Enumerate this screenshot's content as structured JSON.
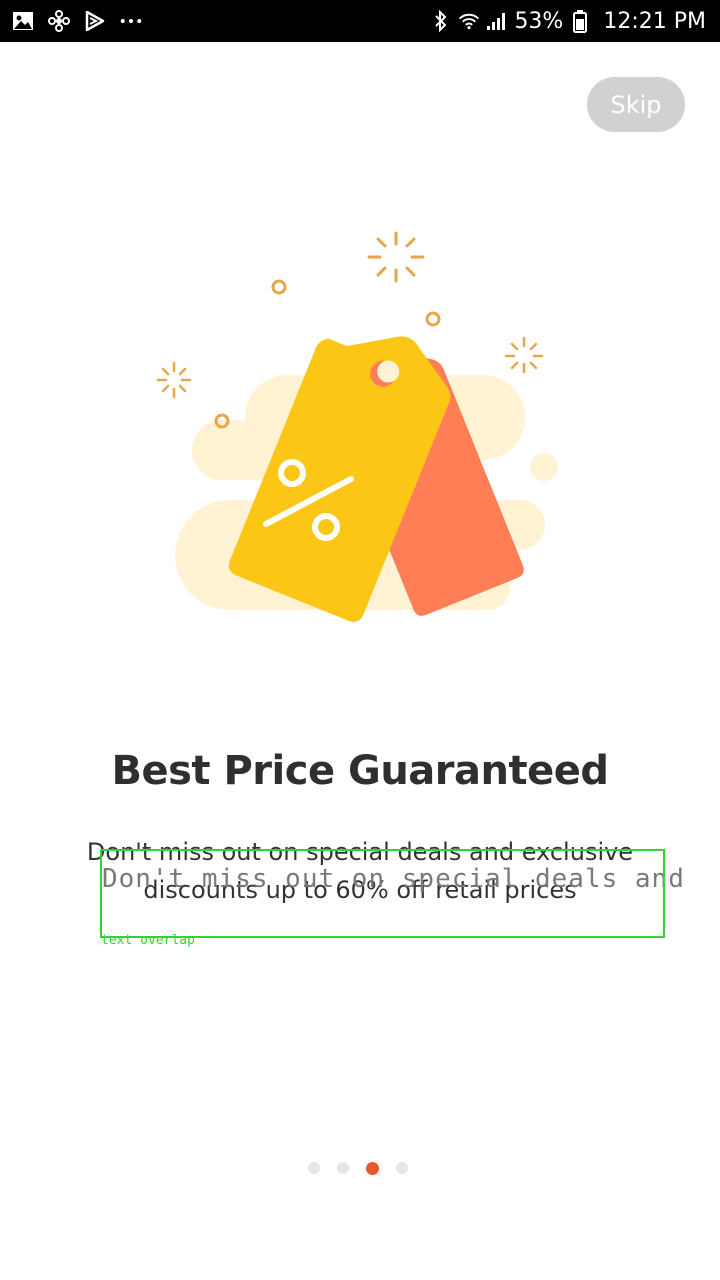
{
  "status_bar": {
    "left_icons": [
      "gallery-icon",
      "pinwheel-icon",
      "play-store-icon",
      "more-dots-icon"
    ],
    "right_icons": [
      "bluetooth-icon",
      "wifi-icon",
      "signal-icon",
      "battery-icon"
    ],
    "battery": "53%",
    "time": "12:21 PM"
  },
  "skip": {
    "label": "Skip"
  },
  "onboarding": {
    "title": "Best Price Guaranteed",
    "description": "Don't miss out on special deals and exclusive discounts up to 60% off retail prices"
  },
  "debug_overlay": {
    "text": "Don't miss out on special deals and",
    "label": "text overlap"
  },
  "pager": {
    "count": 4,
    "active_index": 2,
    "active_color": "#e4582a"
  },
  "colors": {
    "tag_yellow": "#fbc616",
    "tag_orange": "#ff7e55",
    "cloud": "#fff2cf",
    "sparkle": "#e8a649"
  }
}
